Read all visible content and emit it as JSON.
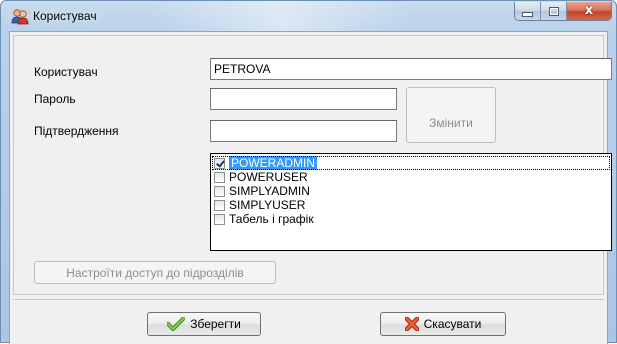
{
  "window": {
    "title": "Користувач",
    "close_label": "x"
  },
  "form": {
    "user_label": "Користувач",
    "user_value": "PETROVA",
    "password_label": "Пароль",
    "password_value": "",
    "confirm_label": "Підтвердження",
    "confirm_value": "",
    "change_button": "Змінити"
  },
  "roles": [
    {
      "label": "POWERADMIN",
      "checked": true,
      "focused": true
    },
    {
      "label": "POWERUSER",
      "checked": false,
      "focused": false
    },
    {
      "label": "SIMPLYADMIN",
      "checked": false,
      "focused": false
    },
    {
      "label": "SIMPLYUSER",
      "checked": false,
      "focused": false
    },
    {
      "label": "Табель і графік",
      "checked": false,
      "focused": false
    }
  ],
  "access_button": "Настроїти доступ до підрозділів",
  "footer": {
    "save_button": "Зберегти",
    "cancel_button": "Скасувати"
  },
  "colors": {
    "selection": "#3399ff",
    "save_icon": "#5cb030",
    "cancel_icon": "#e8401c"
  },
  "icons": {
    "app": "users-icon",
    "save": "checkmark-icon",
    "cancel": "red-x-icon"
  }
}
